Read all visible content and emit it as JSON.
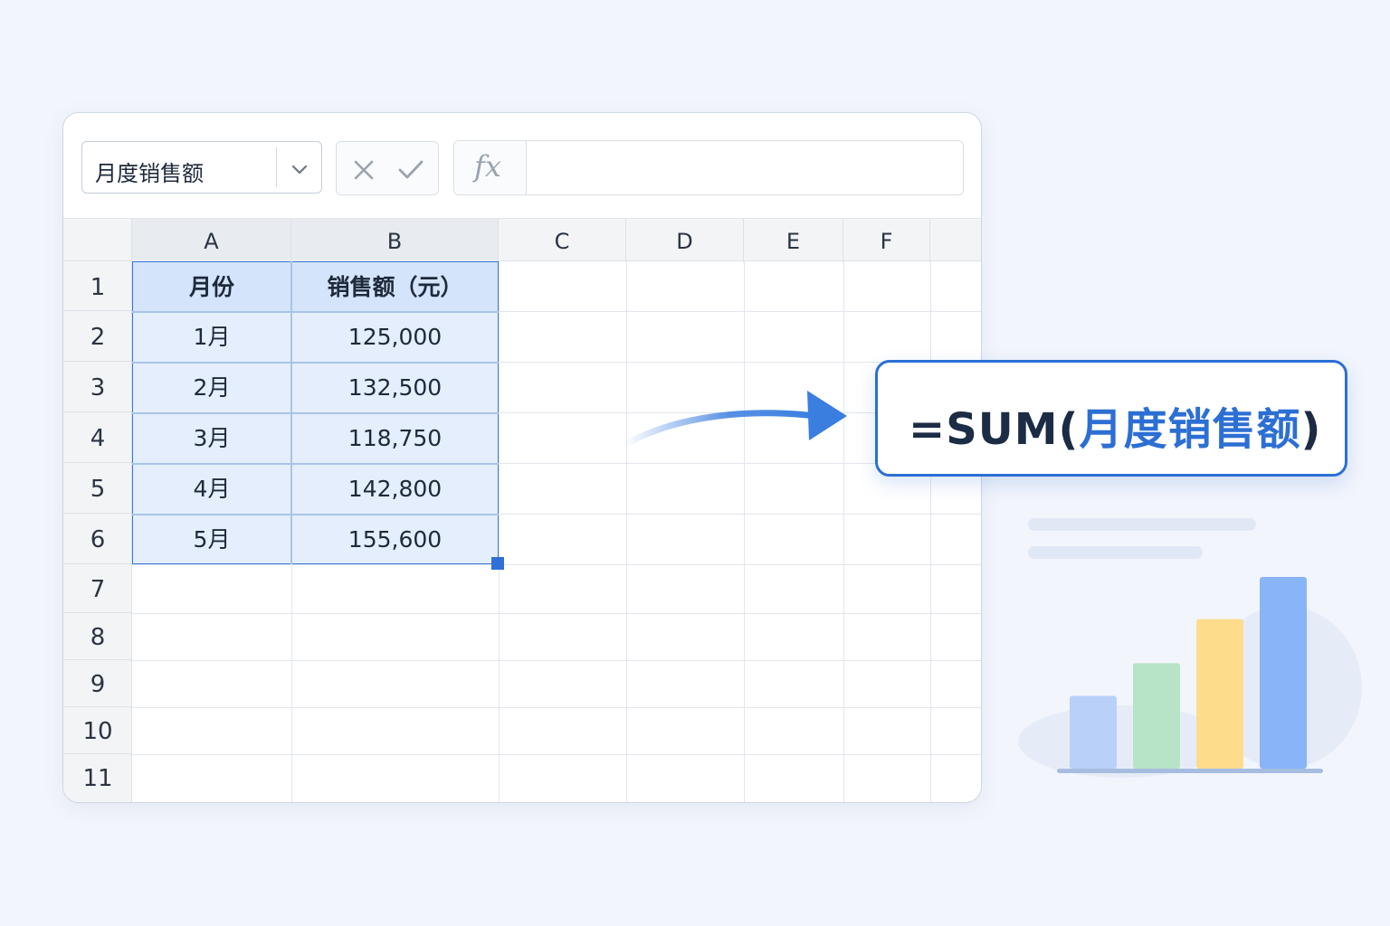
{
  "toolbar": {
    "name_box_value": "月度销售额",
    "cancel_icon": "close-icon",
    "confirm_icon": "check-icon",
    "fx_label": "fx",
    "formula_value": ""
  },
  "sheet": {
    "columns": [
      "A",
      "B",
      "C",
      "D",
      "E",
      "F"
    ],
    "rows": [
      "1",
      "2",
      "3",
      "4",
      "5",
      "6",
      "7",
      "8",
      "9",
      "10",
      "11"
    ],
    "header": {
      "a": "月份",
      "b": "销售额（元）"
    },
    "data": [
      {
        "month": "1月",
        "sales": "125,000"
      },
      {
        "month": "2月",
        "sales": "132,500"
      },
      {
        "month": "3月",
        "sales": "118,750"
      },
      {
        "month": "4月",
        "sales": "142,800"
      },
      {
        "month": "5月",
        "sales": "155,600"
      }
    ],
    "selected_range": "A1:B6"
  },
  "callout": {
    "prefix": "=SUM(",
    "argument": "月度销售额",
    "suffix": ")"
  },
  "colors": {
    "accent": "#2c6fd4",
    "bar_blue_light": "#b9d0f8",
    "bar_green": "#b7e3c6",
    "bar_yellow": "#fddc8c",
    "bar_blue": "#8ab4f8"
  },
  "illustration": {
    "bars": [
      0.38,
      0.55,
      0.78,
      1.0
    ]
  }
}
